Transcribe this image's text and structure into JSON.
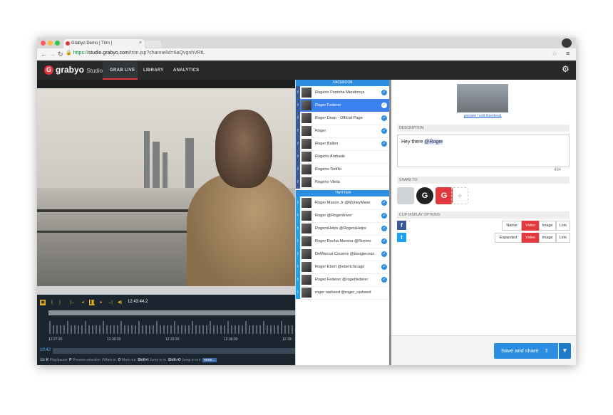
{
  "browser": {
    "tab_title": "Grabyo Demo | Trim |",
    "url_scheme": "https://",
    "url_host": "studio.grabyo.com",
    "url_path": "/trim.jsp?channelId=6aQvqnhVRtL"
  },
  "app": {
    "brand": "grabyo",
    "brand_suffix": "Studio",
    "nav": [
      "GRAB LIVE",
      "LIBRARY",
      "ANALYTICS"
    ],
    "active_nav": "GRAB LIVE"
  },
  "timeline": {
    "timecode": "12:43:44.2",
    "tick_labels": [
      "12:27:20",
      "12:30:20",
      "12:33:20",
      "12:36:20",
      "12:39:"
    ],
    "current_time": "10:42",
    "hints": [
      {
        "key": "K",
        "text": "Play/pause"
      },
      {
        "key": "P",
        "text": "Preview selection"
      },
      {
        "key": "I",
        "text": "Mark in"
      },
      {
        "key": "O",
        "text": "Mark out"
      },
      {
        "key": "Shift+I",
        "text": "Jump to in"
      },
      {
        "key": "Shift+O",
        "text": "Jump to out"
      }
    ],
    "more": "more..."
  },
  "lists": {
    "facebook_header": "FACEBOOK",
    "twitter_header": "TWITTER",
    "facebook": [
      "Rogério Peninha Mendonça",
      "Roger Federer",
      "Roger Dean - Official Page",
      "Roger",
      "Roger Ballen",
      "Rogério Andrade",
      "Rogério Teófilo",
      "Rogério Vilela"
    ],
    "twitter": [
      "Roger Mason Jr @MoneyMase",
      "Roger @Rogerdriver",
      "RogersHelps @RogersHelps",
      "Roger Rocha Moreira @Roxmo",
      "DeMarcus Cousins @boogiecous",
      "Roger Ebert @ebertchicago",
      "Roger Federer @rogerfederer",
      "roger rasheed @roger_rasheed"
    ]
  },
  "panel": {
    "thumbnail_link": "preview / edit thumbnail",
    "description_label": "DESCRIPTION:",
    "description_prefix": "Hey there ",
    "description_mention": "@Roger",
    "char_count": "484",
    "share_label": "SHARE TO:",
    "clip_label": "CLIP DISPLAY OPTIONS:",
    "facebook_options": [
      "Native",
      "Video",
      "Image",
      "Link"
    ],
    "twitter_options": [
      "Expanded",
      "Video",
      "Image",
      "Link"
    ],
    "save_button": "Save and share"
  },
  "colors": {
    "accent_red": "#e1383e",
    "facebook_blue": "#3b5998",
    "twitter_blue": "#1da1f2",
    "primary_blue": "#2c8ee0"
  }
}
